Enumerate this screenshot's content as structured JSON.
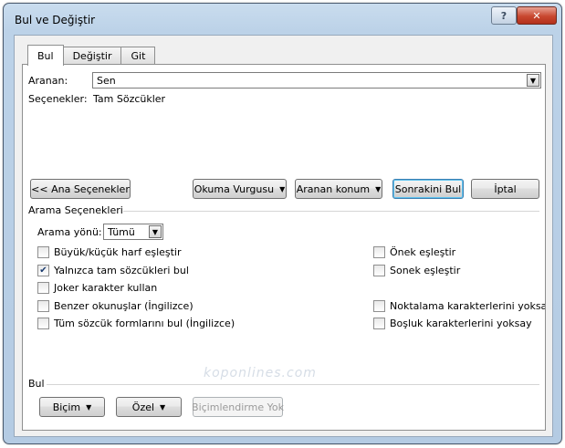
{
  "window": {
    "title": "Bul ve Değiştir",
    "help_glyph": "?",
    "close_glyph": "✕"
  },
  "tabs": [
    {
      "label": "Bul",
      "active": true
    },
    {
      "label": "Değiştir",
      "active": false
    },
    {
      "label": "Git",
      "active": false
    }
  ],
  "search": {
    "label": "Aranan:",
    "value": "Sen",
    "options_label": "Seçenekler:",
    "options_value": "Tam Sözcükler"
  },
  "buttons": {
    "less_options": "<< Ana Seçenekler",
    "reading_highlight": "Okuma Vurgusu",
    "find_in": "Aranan konum",
    "find_next": "Sonrakini Bul",
    "cancel": "İptal"
  },
  "search_options": {
    "title": "Arama Seçenekleri",
    "direction_label": "Arama yönü:",
    "direction_value": "Tümü",
    "left_checks": [
      {
        "label": "Büyük/küçük harf eşleştir",
        "checked": false
      },
      {
        "label": "Yalnızca tam sözcükleri bul",
        "checked": true
      },
      {
        "label": "Joker karakter kullan",
        "checked": false
      },
      {
        "label": "Benzer okunuşlar (İngilizce)",
        "checked": false
      },
      {
        "label": "Tüm sözcük formlarını bul (İngilizce)",
        "checked": false
      }
    ],
    "right_checks": [
      {
        "label": "Önek eşleştir",
        "checked": false
      },
      {
        "label": "Sonek eşleştir",
        "checked": false
      },
      {
        "label": "Noktalama karakterlerini yoksay",
        "checked": false
      },
      {
        "label": "Boşluk karakterlerini yoksay",
        "checked": false
      }
    ]
  },
  "find_section": {
    "title": "Bul",
    "format_button": "Biçim",
    "special_button": "Özel",
    "no_formatting_button": "Biçimlendirme Yok"
  },
  "watermark": "koponlines.com",
  "colors": {
    "title_gradient_top": "#c9dcee",
    "close_red": "#c8472f",
    "default_button_border": "#3c7fb1"
  }
}
